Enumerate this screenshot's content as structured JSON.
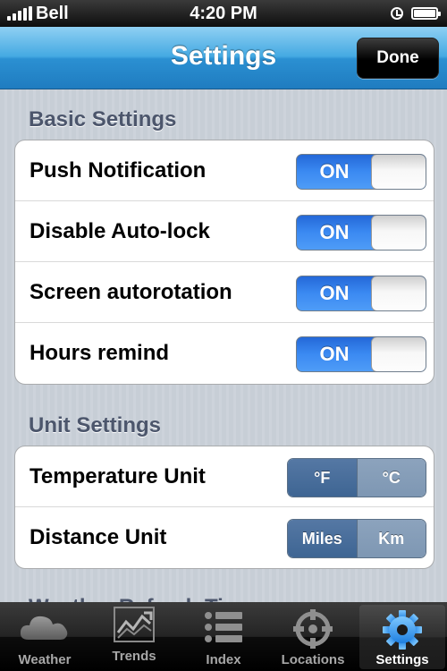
{
  "status_bar": {
    "carrier": "Bell",
    "time": "4:20 PM",
    "icons": [
      "signal-icon",
      "alarm-icon",
      "battery-icon"
    ]
  },
  "nav_bar": {
    "title": "Settings",
    "done_label": "Done"
  },
  "basic_settings": {
    "header": "Basic Settings",
    "rows": [
      {
        "label": "Push Notification",
        "state": "ON"
      },
      {
        "label": "Disable Auto-lock",
        "state": "ON"
      },
      {
        "label": "Screen autorotation",
        "state": "ON"
      },
      {
        "label": "Hours remind",
        "state": "ON"
      }
    ]
  },
  "unit_settings": {
    "header": "Unit Settings",
    "temperature": {
      "label": "Temperature Unit",
      "options": [
        "°F",
        "°C"
      ],
      "selected": "°F"
    },
    "distance": {
      "label": "Distance Unit",
      "options": [
        "Miles",
        "Km"
      ],
      "selected": "Miles"
    }
  },
  "partially_visible_section": "Weather Refresh Time",
  "tab_bar": {
    "tabs": [
      {
        "label": "Weather",
        "icon": "cloud-icon"
      },
      {
        "label": "Trends",
        "icon": "chart-icon"
      },
      {
        "label": "Index",
        "icon": "list-icon"
      },
      {
        "label": "Locations",
        "icon": "crosshair-icon"
      },
      {
        "label": "Settings",
        "icon": "gear-icon"
      }
    ],
    "active": "Settings"
  },
  "colors": {
    "nav_blue": "#2b90d2",
    "switch_on_blue": "#3b8af2",
    "segment_selected": "#3e6593",
    "segment_unselected": "#7e97b3",
    "section_header": "#4c566c"
  }
}
